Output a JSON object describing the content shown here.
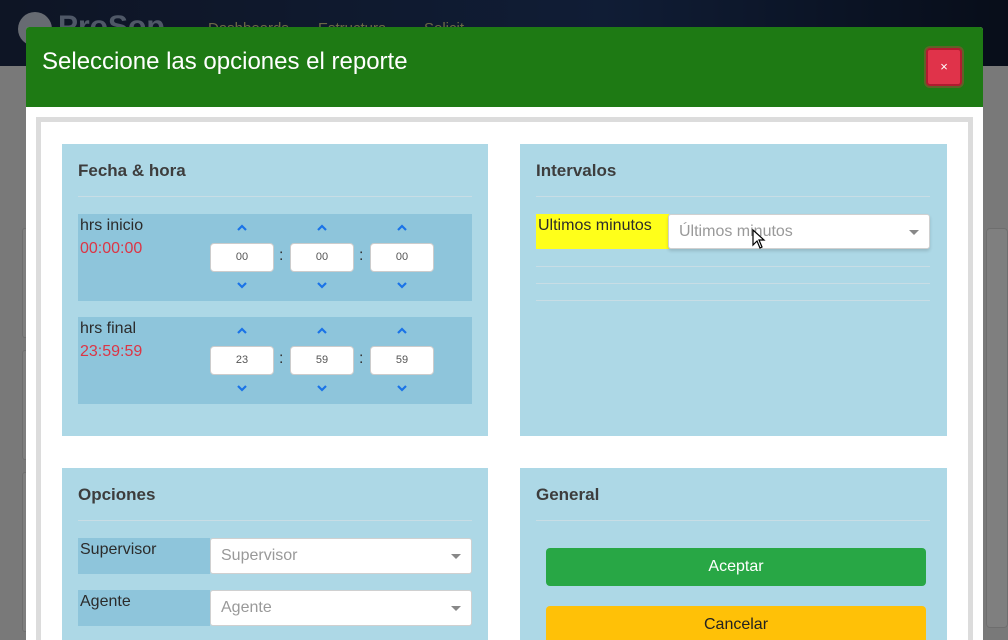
{
  "background": {
    "brand": "ProSop",
    "nav_links": [
      "Dashboards",
      "Estructura",
      "Solicit..."
    ]
  },
  "modal": {
    "title": "Seleccione las opciones el reporte",
    "close_label": "×"
  },
  "fecha_hora": {
    "title": "Fecha & hora",
    "inicio": {
      "label": "hrs inicio",
      "value": "00:00:00",
      "hh": "00",
      "mm": "00",
      "ss": "00"
    },
    "final": {
      "label": "hrs final",
      "value": "23:59:59",
      "hh": "23",
      "mm": "59",
      "ss": "59"
    },
    "separator": ":"
  },
  "intervalos": {
    "title": "Intervalos",
    "label": "Ultimos minutos",
    "placeholder": "Últimos minutos"
  },
  "opciones": {
    "title": "Opciones",
    "supervisor_label": "Supervisor",
    "supervisor_placeholder": "Supervisor",
    "agente_label": "Agente",
    "agente_placeholder": "Agente"
  },
  "general": {
    "title": "General",
    "accept_label": "Aceptar",
    "cancel_label": "Cancelar"
  },
  "colors": {
    "header_green": "#1e7a14",
    "panel_blue": "#add8e6",
    "box_blue": "#8ec5db",
    "time_red": "#dc3545",
    "highlight_yellow": "#ffff1a",
    "accept_green": "#28a745",
    "cancel_yellow": "#ffc107",
    "close_red": "#e0334a",
    "chevron_blue": "#1a73e8"
  }
}
